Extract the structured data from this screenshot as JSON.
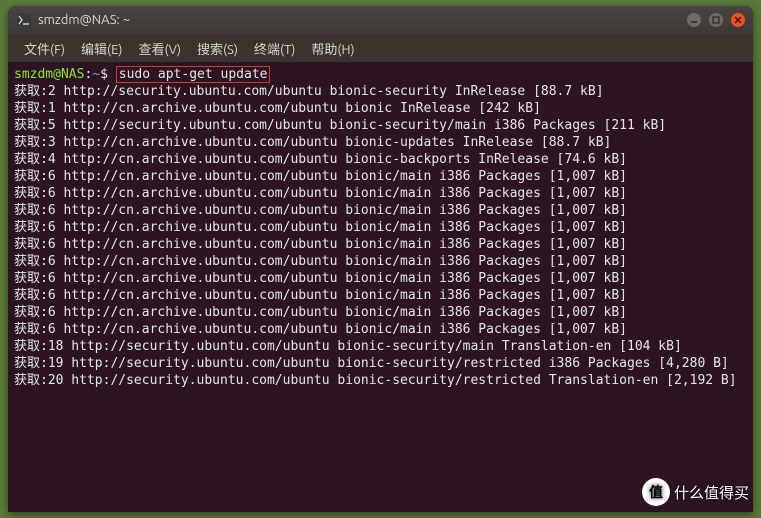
{
  "window": {
    "title": "smzdm@NAS: ~"
  },
  "menubar": {
    "items": [
      "文件(F)",
      "编辑(E)",
      "查看(V)",
      "搜索(S)",
      "终端(T)",
      "帮助(H)"
    ]
  },
  "prompt": {
    "userhost": "smzdm@NAS",
    "sep1": ":",
    "path": "~",
    "sep2": "$",
    "command": "sudo apt-get update"
  },
  "output_lines": [
    "获取:2 http://security.ubuntu.com/ubuntu bionic-security InRelease [88.7 kB]",
    "获取:1 http://cn.archive.ubuntu.com/ubuntu bionic InRelease [242 kB]",
    "获取:5 http://security.ubuntu.com/ubuntu bionic-security/main i386 Packages [211 kB]",
    "获取:3 http://cn.archive.ubuntu.com/ubuntu bionic-updates InRelease [88.7 kB]",
    "获取:4 http://cn.archive.ubuntu.com/ubuntu bionic-backports InRelease [74.6 kB]",
    "获取:6 http://cn.archive.ubuntu.com/ubuntu bionic/main i386 Packages [1,007 kB]",
    "获取:6 http://cn.archive.ubuntu.com/ubuntu bionic/main i386 Packages [1,007 kB]",
    "获取:6 http://cn.archive.ubuntu.com/ubuntu bionic/main i386 Packages [1,007 kB]",
    "获取:6 http://cn.archive.ubuntu.com/ubuntu bionic/main i386 Packages [1,007 kB]",
    "获取:6 http://cn.archive.ubuntu.com/ubuntu bionic/main i386 Packages [1,007 kB]",
    "获取:6 http://cn.archive.ubuntu.com/ubuntu bionic/main i386 Packages [1,007 kB]",
    "获取:6 http://cn.archive.ubuntu.com/ubuntu bionic/main i386 Packages [1,007 kB]",
    "获取:6 http://cn.archive.ubuntu.com/ubuntu bionic/main i386 Packages [1,007 kB]",
    "获取:6 http://cn.archive.ubuntu.com/ubuntu bionic/main i386 Packages [1,007 kB]",
    "获取:6 http://cn.archive.ubuntu.com/ubuntu bionic/main i386 Packages [1,007 kB]",
    "获取:18 http://security.ubuntu.com/ubuntu bionic-security/main Translation-en [104 kB]",
    "获取:19 http://security.ubuntu.com/ubuntu bionic-security/restricted i386 Packages [4,280 B]",
    "获取:20 http://security.ubuntu.com/ubuntu bionic-security/restricted Translation-en [2,192 B]"
  ],
  "watermark": {
    "badge": "值",
    "text": "什么值得买"
  }
}
